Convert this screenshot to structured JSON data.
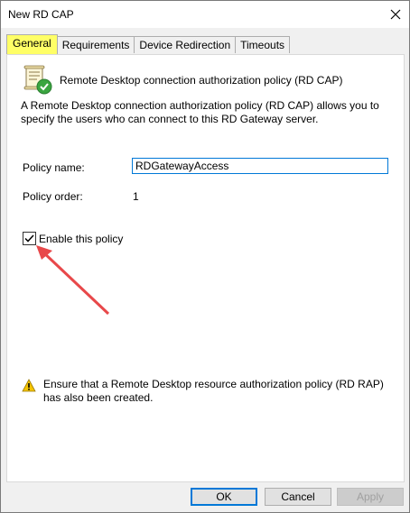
{
  "window": {
    "title": "New RD CAP"
  },
  "tabs": [
    {
      "label": "General",
      "active": true
    },
    {
      "label": "Requirements",
      "active": false
    },
    {
      "label": "Device Redirection",
      "active": false
    },
    {
      "label": "Timeouts",
      "active": false
    }
  ],
  "general": {
    "header": "Remote Desktop connection authorization policy (RD CAP)",
    "description": "A Remote Desktop connection authorization policy (RD CAP) allows you to specify the users who can connect to this RD Gateway server.",
    "policy_name_label": "Policy name:",
    "policy_name_value": "RDGatewayAccess",
    "policy_order_label": "Policy order:",
    "policy_order_value": "1",
    "enable_label": "Enable this policy",
    "enable_checked": true,
    "warning": "Ensure that a Remote Desktop resource authorization policy (RD RAP) has also been created."
  },
  "buttons": {
    "ok": "OK",
    "cancel": "Cancel",
    "apply": "Apply"
  },
  "annotation": {
    "arrow_color": "#e8484a",
    "highlight_color": "#ffff66"
  },
  "icons": {
    "policy": "policy-scroll-icon",
    "warning": "warning-icon",
    "close": "close-icon"
  }
}
